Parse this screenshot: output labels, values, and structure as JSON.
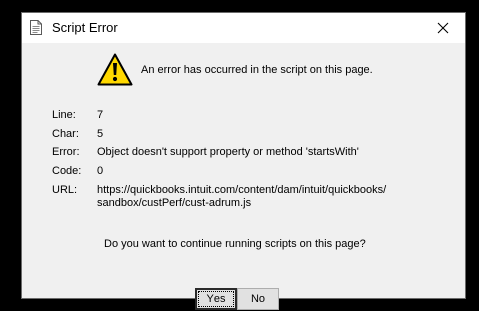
{
  "window": {
    "title": "Script Error",
    "close_glyph": "✕"
  },
  "message": "An error has occurred in the script on this page.",
  "fields": {
    "line_label": "Line:",
    "line_value": "7",
    "char_label": "Char:",
    "char_value": "5",
    "error_label": "Error:",
    "error_value": "Object doesn't support property or method 'startsWith'",
    "code_label": "Code:",
    "code_value": "0",
    "url_label": "URL:",
    "url_value_line1": "https://quickbooks.intuit.com/content/dam/intuit/quickbooks/",
    "url_value_line2": "sandbox/custPerf/cust-adrum.js"
  },
  "question": "Do you want to continue running scripts on this page?",
  "buttons": {
    "yes_mnemonic": "Y",
    "yes_rest": "es",
    "no_mnemonic": "N",
    "no_rest": "o"
  },
  "icons": {
    "title_icon": "document-icon",
    "warning_icon": "warning-icon",
    "close_icon": "close-icon"
  },
  "colors": {
    "warning_fill": "#ffd800",
    "dialog_bg": "#f0f0f0",
    "titlebar_bg": "#ffffff"
  }
}
